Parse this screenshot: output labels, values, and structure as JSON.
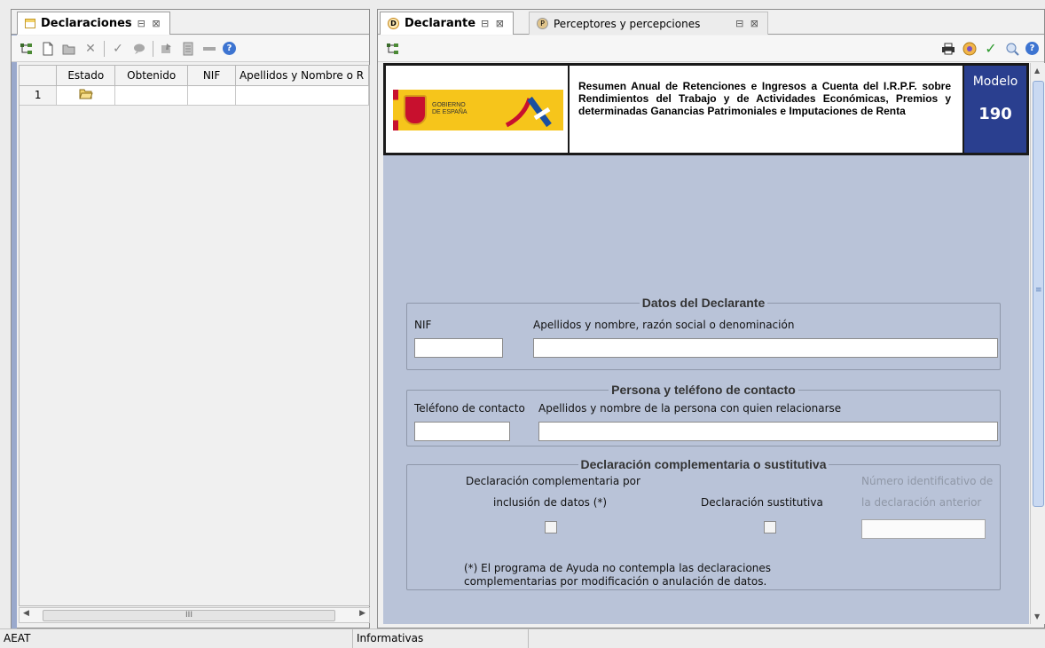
{
  "left_panel": {
    "tab_label": "Declaraciones",
    "tab_controls": "⊟ ⊠",
    "grid": {
      "columns": [
        "Estado",
        "Obtenido",
        "NIF",
        "Apellidos y Nombre o R"
      ],
      "rows": [
        {
          "num": "1",
          "estado_icon": "folder-open-icon",
          "obtenido": "",
          "nif": "",
          "apellidos": ""
        }
      ]
    },
    "hscroll_grip": "III"
  },
  "right_panel": {
    "tabs": [
      {
        "label": "Declarante",
        "controls": "⊟ ⊠",
        "active": true
      },
      {
        "label": "Perceptores y percepciones",
        "controls": "⊟ ⊠",
        "active": false
      }
    ],
    "header": {
      "logo_text_line1": "GOBIERNO",
      "logo_text_line2": "DE ESPAÑA",
      "title": "Resumen Anual de Retenciones e Ingresos a Cuenta del I.R.P.F. sobre Rendimientos del Trabajo y de Actividades Económicas, Premios y determinadas Ganancias Patrimoniales e Imputaciones de Renta",
      "modelo_label": "Modelo",
      "modelo_number": "190"
    },
    "datos_declarante": {
      "legend": "Datos del Declarante",
      "nif_label": "NIF",
      "nif_value": "",
      "nombre_label": "Apellidos y nombre, razón social o denominación",
      "nombre_value": ""
    },
    "persona_contacto": {
      "legend": "Persona y teléfono de contacto",
      "telefono_label": "Teléfono de contacto",
      "telefono_value": "",
      "nombre_label": "Apellidos y nombre de la persona con quien relacionarse",
      "nombre_value": ""
    },
    "complementaria": {
      "legend": "Declaración complementaria o sustitutiva",
      "complementaria_label_line1": "Declaración complementaria por",
      "complementaria_label_line2": "inclusión de datos (*)",
      "sustitutiva_label": "Declaración sustitutiva",
      "numero_label_line1": "Número identificativo de",
      "numero_label_line2": "la declaración anterior",
      "numero_value": "",
      "note_line1": "(*) El programa de Ayuda no contempla las declaraciones",
      "note_line2": "complementarias por modificación o anulación de datos."
    }
  },
  "status_bar": {
    "left": "AEAT",
    "middle": "Informativas",
    "right": ""
  },
  "colors": {
    "form_background": "#b9c3d8",
    "modelo_background": "#2a3f8f",
    "help_icon": "#3d74d1",
    "check_icon": "#2e9b2e"
  }
}
